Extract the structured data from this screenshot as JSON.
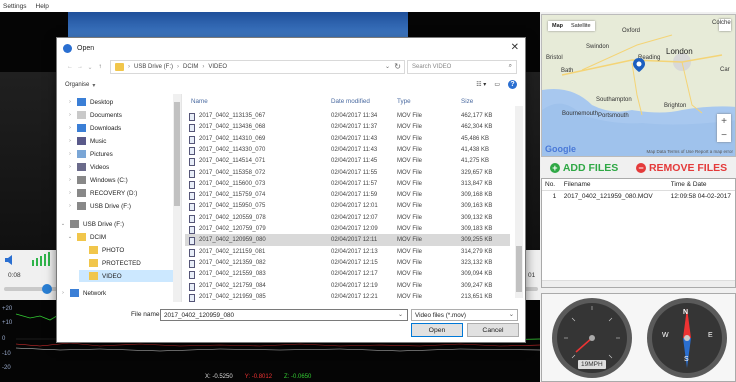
{
  "menubar": {
    "items": [
      "Settings",
      "Help"
    ]
  },
  "player": {
    "time_current": "0:08",
    "time_end": "01"
  },
  "graph": {
    "y_labels": [
      "+20",
      "+10",
      "0",
      "-10",
      "-20"
    ],
    "readout": {
      "x": "X: -0.5250",
      "y": "Y: -0.8012",
      "z": "Z: -0.0650"
    }
  },
  "map": {
    "tabs": [
      "Map",
      "Satellite"
    ],
    "cities": [
      "Oxford",
      "London",
      "Reading",
      "Swindon",
      "Bristol",
      "Bath",
      "Southampton",
      "Brighton",
      "Bournemouth",
      "Portsmouth",
      "Colche",
      "Car"
    ],
    "google": "Google",
    "terms": "Map Data  Terms of Use  Report a map error"
  },
  "file_buttons": {
    "add": "ADD FILES",
    "remove": "REMOVE FILES"
  },
  "filelist": {
    "headers": [
      "No.",
      "Filename",
      "Time & Date"
    ],
    "rows": [
      {
        "no": "1",
        "filename": "2017_0402_121959_080.MOV",
        "time": "12:09:58 04-02-2017"
      }
    ]
  },
  "gauges": {
    "speed": "19MPH"
  },
  "dialog": {
    "title": "Open",
    "breadcrumb": [
      "USB Drive (F:)",
      "DCIM",
      "VIDEO"
    ],
    "search_placeholder": "Search VIDEO",
    "organise": "Organise",
    "nav": [
      {
        "label": "Desktop",
        "icon": "desktop"
      },
      {
        "label": "Documents",
        "icon": "documents"
      },
      {
        "label": "Downloads",
        "icon": "downloads"
      },
      {
        "label": "Music",
        "icon": "music"
      },
      {
        "label": "Pictures",
        "icon": "pictures"
      },
      {
        "label": "Videos",
        "icon": "videos"
      },
      {
        "label": "Windows (C:)",
        "icon": "drive"
      },
      {
        "label": "RECOVERY (D:)",
        "icon": "drive"
      },
      {
        "label": "USB Drive (F:)",
        "icon": "drive"
      },
      {
        "label": "USB Drive (F:)",
        "icon": "drive"
      },
      {
        "label": "DCIM",
        "icon": "folder"
      },
      {
        "label": "PHOTO",
        "icon": "folder"
      },
      {
        "label": "PROTECTED",
        "icon": "folder"
      },
      {
        "label": "VIDEO",
        "icon": "folder"
      },
      {
        "label": "Network",
        "icon": "network"
      }
    ],
    "columns": [
      "Name",
      "Date modified",
      "Type",
      "Size"
    ],
    "files": [
      {
        "name": "2017_0402_113135_067",
        "date": "02/04/2017 11:34",
        "type": "MOV File",
        "size": "462,177 KB"
      },
      {
        "name": "2017_0402_113436_068",
        "date": "02/04/2017 11:37",
        "type": "MOV File",
        "size": "462,304 KB"
      },
      {
        "name": "2017_0402_114310_069",
        "date": "02/04/2017 11:43",
        "type": "MOV File",
        "size": "45,486 KB"
      },
      {
        "name": "2017_0402_114330_070",
        "date": "02/04/2017 11:43",
        "type": "MOV File",
        "size": "41,438 KB"
      },
      {
        "name": "2017_0402_114514_071",
        "date": "02/04/2017 11:45",
        "type": "MOV File",
        "size": "41,275 KB"
      },
      {
        "name": "2017_0402_115358_072",
        "date": "02/04/2017 11:55",
        "type": "MOV File",
        "size": "329,657 KB"
      },
      {
        "name": "2017_0402_115600_073",
        "date": "02/04/2017 11:57",
        "type": "MOV File",
        "size": "313,847 KB"
      },
      {
        "name": "2017_0402_115759_074",
        "date": "02/04/2017 11:59",
        "type": "MOV File",
        "size": "309,168 KB"
      },
      {
        "name": "2017_0402_115950_075",
        "date": "02/04/2017 12:01",
        "type": "MOV File",
        "size": "309,163 KB"
      },
      {
        "name": "2017_0402_120559_078",
        "date": "02/04/2017 12:07",
        "type": "MOV File",
        "size": "309,132 KB"
      },
      {
        "name": "2017_0402_120759_079",
        "date": "02/04/2017 12:09",
        "type": "MOV File",
        "size": "309,183 KB"
      },
      {
        "name": "2017_0402_120959_080",
        "date": "02/04/2017 12:11",
        "type": "MOV File",
        "size": "309,255 KB"
      },
      {
        "name": "2017_0402_121159_081",
        "date": "02/04/2017 12:13",
        "type": "MOV File",
        "size": "314,279 KB"
      },
      {
        "name": "2017_0402_121359_082",
        "date": "02/04/2017 12:15",
        "type": "MOV File",
        "size": "323,132 KB"
      },
      {
        "name": "2017_0402_121559_083",
        "date": "02/04/2017 12:17",
        "type": "MOV File",
        "size": "309,094 KB"
      },
      {
        "name": "2017_0402_121759_084",
        "date": "02/04/2017 12:19",
        "type": "MOV File",
        "size": "309,247 KB"
      },
      {
        "name": "2017_0402_121959_085",
        "date": "02/04/2017 12:21",
        "type": "MOV File",
        "size": "213,651 KB"
      }
    ],
    "selected_index": 11,
    "filename_label": "File name:",
    "filename_value": "2017_0402_120959_080",
    "filetype": "Video files (*.mov)",
    "open": "Open",
    "cancel": "Cancel"
  },
  "colors": {
    "accent": "#0078d7",
    "add": "#2fa845",
    "remove": "#e43a3a"
  }
}
